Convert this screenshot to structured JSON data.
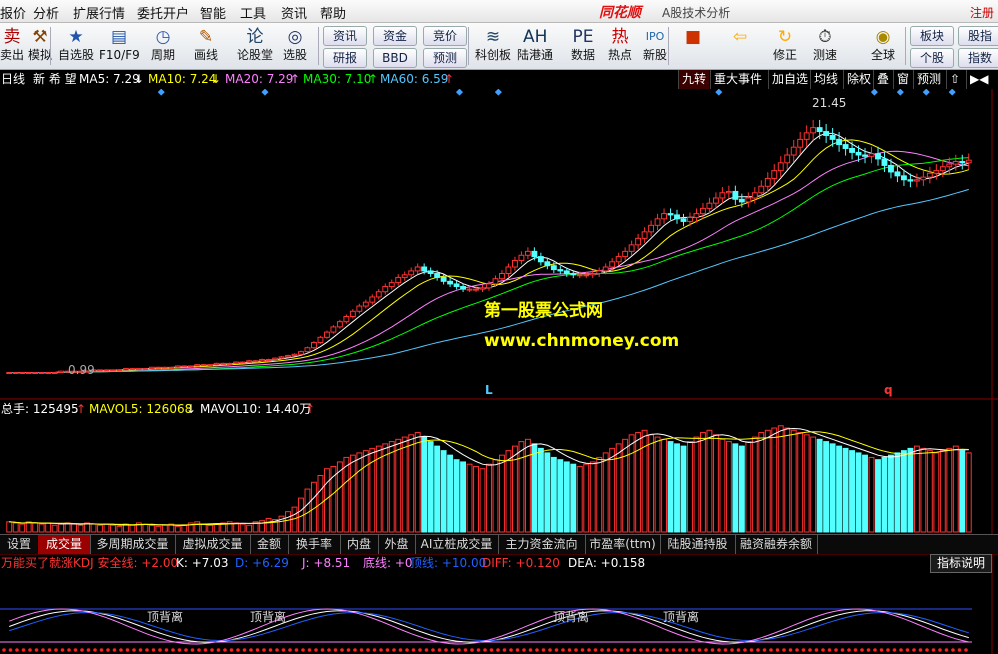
{
  "menu": [
    "报价",
    "分析",
    "扩展行情",
    "委托开户",
    "智能",
    "工具",
    "资讯",
    "帮助"
  ],
  "logo": "同花顺",
  "app_title": "A股技术分析",
  "register": "注册",
  "toolbar": {
    "items": [
      {
        "label": "卖出",
        "icon": "sell-icon",
        "glyph": "卖"
      },
      {
        "label": "模拟",
        "icon": "hammer-icon",
        "glyph": "⚒"
      },
      {
        "label": "自选股",
        "icon": "star-icon",
        "glyph": "★"
      },
      {
        "label": "F10/F9",
        "icon": "window-icon",
        "glyph": "▤"
      },
      {
        "label": "周期",
        "icon": "clock-icon",
        "glyph": "◷"
      },
      {
        "label": "画线",
        "icon": "pen-icon",
        "glyph": "✎"
      },
      {
        "label": "论股堂",
        "icon": "forum-icon",
        "glyph": "论"
      },
      {
        "label": "选股",
        "icon": "screen-icon",
        "glyph": "◎"
      },
      {
        "label": "科创板",
        "icon": "chart-icon",
        "glyph": "≋"
      },
      {
        "label": "陆港通",
        "icon": "ah-icon",
        "glyph": "AH"
      },
      {
        "label": "数据",
        "icon": "pe-icon",
        "glyph": "PE"
      },
      {
        "label": "热点",
        "icon": "hot-icon",
        "glyph": "热"
      },
      {
        "label": "新股",
        "icon": "ipo-icon",
        "glyph": "IPO"
      },
      {
        "label": "",
        "icon": "colors-icon",
        "glyph": "■"
      },
      {
        "label": "",
        "icon": "back-arrow-icon",
        "glyph": "⇦"
      },
      {
        "label": "修正",
        "icon": "refresh-icon",
        "glyph": "↻"
      },
      {
        "label": "测速",
        "icon": "timer-icon",
        "glyph": "⏱"
      },
      {
        "label": "全球",
        "icon": "globe-icon",
        "glyph": "◉"
      }
    ],
    "small_buttons": [
      "资讯",
      "研报",
      "资金",
      "BBD",
      "竞价",
      "预测",
      "板块",
      "个股",
      "股指",
      "指数"
    ]
  },
  "quote_info": {
    "period": "日线",
    "stock_name": "新 希 望",
    "ma5": "MA5: 7.29",
    "ma10": "MA10: 7.24",
    "ma20": "MA20: 7.29",
    "ma30": "MA30: 7.10",
    "ma60": "MA60: 6.59",
    "arrow_up": "↑",
    "arrow_down": "↓"
  },
  "right_buttons": [
    "九转",
    "重大事件",
    "加自选",
    "均线",
    "除权",
    "叠",
    "窗",
    "预测",
    "⇧",
    "▶◀"
  ],
  "price_annotations": {
    "high": "21.45",
    "low": "0.99"
  },
  "watermark": {
    "line1": "第一股票公式网",
    "line2": "www.chnmoney.com"
  },
  "markers": {
    "l": "L",
    "q": "q"
  },
  "volume_info": {
    "total": "总手: 125495",
    "mavol5": "MAVOL5: 126068",
    "mavol10": "MAVOL10: 14.40万"
  },
  "tabs": [
    "设置",
    "成交量",
    "多周期成交量",
    "虚拟成交量",
    "金额",
    "换手率",
    "内盘",
    "外盘",
    "AI立桩成交量",
    "主力资金流向",
    "市盈率(ttm)",
    "陆股通持股",
    "融资融券余额"
  ],
  "kdj_info": {
    "name": "万能买了就涨KDJ 安全线: +2.00",
    "k": "K: +7.03",
    "d": "D: +6.29",
    "j": "J: +8.51",
    "bottom": "底线: +0",
    "top": "顶线: +10.00",
    "diff": "DIFF: +0.120",
    "dea": "DEA: +0.158"
  },
  "help_button": "指标说明",
  "divergence_label": "顶背离",
  "colors": {
    "up": "#ff3232",
    "down": "#54ffff",
    "ma5": "#ffffff",
    "ma10": "#ffff00",
    "ma20": "#ff80ff",
    "ma30": "#00ff00",
    "ma60": "#54c8ff"
  },
  "chart_data": {
    "type": "candlestick",
    "series": [
      {
        "name": "K线",
        "close": [
          1.0,
          1.0,
          1.0,
          1.0,
          1.0,
          1.0,
          1.0,
          1.0,
          1.1,
          1.1,
          1.1,
          1.1,
          1.1,
          1.2,
          1.2,
          1.2,
          1.2,
          1.2,
          1.3,
          1.3,
          1.3,
          1.3,
          1.4,
          1.4,
          1.4,
          1.4,
          1.5,
          1.5,
          1.5,
          1.6,
          1.6,
          1.6,
          1.7,
          1.7,
          1.7,
          1.8,
          1.8,
          1.9,
          1.9,
          2.0,
          2.0,
          2.1,
          2.2,
          2.3,
          2.4,
          2.6,
          2.9,
          3.3,
          3.7,
          4.1,
          4.5,
          4.9,
          5.3,
          5.7,
          6.1,
          6.4,
          6.8,
          7.2,
          7.6,
          7.9,
          8.3,
          8.5,
          8.8,
          9.1,
          8.8,
          8.6,
          8.3,
          8.0,
          7.8,
          7.6,
          7.4,
          7.4,
          7.4,
          7.5,
          7.8,
          8.2,
          8.6,
          9.1,
          9.6,
          10.0,
          10.3,
          9.9,
          9.5,
          9.2,
          8.9,
          8.8,
          8.6,
          8.5,
          8.5,
          8.5,
          8.6,
          8.8,
          9.1,
          9.5,
          9.9,
          10.3,
          10.8,
          11.3,
          11.8,
          12.3,
          12.8,
          13.2,
          13.1,
          12.8,
          12.6,
          12.9,
          13.2,
          13.6,
          14.0,
          14.4,
          14.8,
          14.9,
          14.3,
          14.1,
          14.4,
          14.8,
          15.3,
          15.9,
          16.5,
          17.1,
          17.7,
          18.3,
          18.9,
          19.4,
          19.8,
          19.5,
          19.2,
          18.9,
          18.5,
          18.2,
          17.9,
          17.7,
          17.6,
          17.8,
          17.4,
          16.9,
          16.4,
          16.1,
          15.8,
          15.7,
          15.8,
          16.0,
          16.3,
          16.5,
          16.8,
          17.0,
          17.2,
          17.1,
          17.3
        ]
      },
      {
        "name": "成交量",
        "values": [
          9,
          8,
          7,
          9,
          8,
          7,
          8,
          6,
          7,
          8,
          7,
          6,
          8,
          7,
          6,
          7,
          6,
          5,
          7,
          6,
          8,
          7,
          6,
          5,
          6,
          7,
          5,
          6,
          8,
          9,
          7,
          6,
          7,
          8,
          9,
          8,
          7,
          6,
          9,
          10,
          12,
          11,
          14,
          18,
          22,
          30,
          38,
          44,
          50,
          56,
          58,
          62,
          66,
          68,
          70,
          72,
          74,
          76,
          78,
          80,
          82,
          84,
          86,
          88,
          84,
          80,
          76,
          72,
          68,
          64,
          62,
          60,
          58,
          56,
          60,
          64,
          68,
          72,
          76,
          80,
          82,
          78,
          74,
          70,
          66,
          64,
          62,
          60,
          58,
          60,
          62,
          66,
          70,
          74,
          78,
          82,
          86,
          88,
          90,
          86,
          84,
          82,
          80,
          78,
          76,
          80,
          84,
          88,
          90,
          86,
          82,
          80,
          78,
          76,
          80,
          84,
          88,
          90,
          92,
          94,
          92,
          90,
          88,
          86,
          84,
          82,
          80,
          78,
          76,
          74,
          72,
          70,
          68,
          66,
          64,
          66,
          68,
          70,
          72,
          74,
          76,
          74,
          72,
          70,
          72,
          74,
          76,
          72,
          70
        ]
      }
    ]
  }
}
